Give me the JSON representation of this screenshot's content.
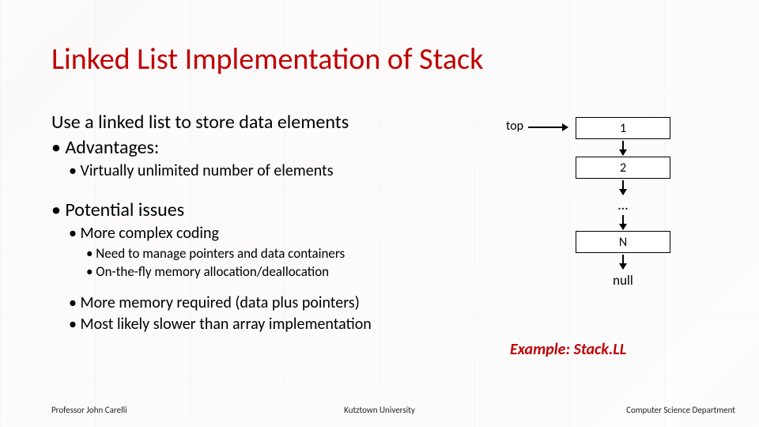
{
  "title": "Linked List Implementation of Stack",
  "body": {
    "line1": "Use a linked list to store data elements",
    "adv_label": "• Advantages:",
    "adv1": "• Virtually unlimited number of elements",
    "issues_label": "• Potential issues",
    "issue1": "• More complex coding",
    "issue1a": "• Need to manage pointers and data containers",
    "issue1b": "• On-the-fly memory allocation/deallocation",
    "issue2": "• More memory required (data plus pointers)",
    "issue3": "• Most likely slower than array implementation"
  },
  "diagram": {
    "top_label": "top",
    "node1": "1",
    "node2": "2",
    "dots": "…",
    "nodeN": "N",
    "null": "null"
  },
  "example": "Example: Stack.LL",
  "footer": {
    "left": "Professor John Carelli",
    "center": "Kutztown University",
    "right": "Computer Science Department"
  }
}
